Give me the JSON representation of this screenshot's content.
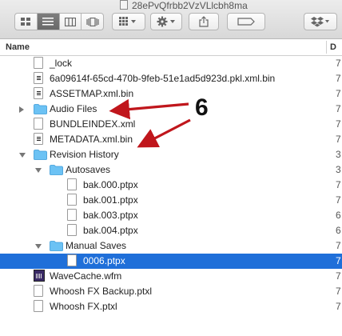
{
  "window": {
    "title": "28ePvQfrbb2VzVLlcbh8ma"
  },
  "toolbar": {
    "view_modes": [
      "icon-view",
      "list-view",
      "column-view",
      "coverflow-view"
    ],
    "active_view": "list-view",
    "arrange_icon": "arrange-grid-icon",
    "action_icon": "gear-icon",
    "share_icon": "share-icon",
    "tags_icon": "tag-icon",
    "dropbox_icon": "dropbox-icon"
  },
  "columns": {
    "name": "Name",
    "date": "D"
  },
  "rows": [
    {
      "label": "_lock",
      "kind": "doc",
      "indent": 0,
      "date": "7"
    },
    {
      "label": "6a09614f-65cd-470b-9feb-51e1ad5d923d.pkl.xml.bin",
      "kind": "bin",
      "indent": 0,
      "date": "7"
    },
    {
      "label": "ASSETMAP.xml.bin",
      "kind": "bin",
      "indent": 0,
      "date": "7"
    },
    {
      "label": "Audio Files",
      "kind": "folder",
      "indent": 0,
      "expanded": false,
      "date": "7"
    },
    {
      "label": "BUNDLEINDEX.xml",
      "kind": "doc",
      "indent": 0,
      "date": "7"
    },
    {
      "label": "METADATA.xml.bin",
      "kind": "bin",
      "indent": 0,
      "date": "7"
    },
    {
      "label": "Revision History",
      "kind": "folder",
      "indent": 0,
      "expanded": true,
      "date": "3"
    },
    {
      "label": "Autosaves",
      "kind": "folder",
      "indent": 1,
      "expanded": true,
      "date": "3"
    },
    {
      "label": "bak.000.ptpx",
      "kind": "doc",
      "indent": 2,
      "date": "7"
    },
    {
      "label": "bak.001.ptpx",
      "kind": "doc",
      "indent": 2,
      "date": "7"
    },
    {
      "label": "bak.003.ptpx",
      "kind": "doc",
      "indent": 2,
      "date": "6"
    },
    {
      "label": "bak.004.ptpx",
      "kind": "doc",
      "indent": 2,
      "date": "6"
    },
    {
      "label": "Manual Saves",
      "kind": "folder",
      "indent": 1,
      "expanded": true,
      "date": "7"
    },
    {
      "label": "0006.ptpx",
      "kind": "doc",
      "indent": 2,
      "date": "7",
      "selected": true
    },
    {
      "label": "WaveCache.wfm",
      "kind": "wfm",
      "indent": 0,
      "date": "7"
    },
    {
      "label": "Whoosh FX Backup.ptxl",
      "kind": "doc",
      "indent": 0,
      "date": "7"
    },
    {
      "label": "Whoosh FX.ptxl",
      "kind": "doc",
      "indent": 0,
      "date": "7"
    }
  ],
  "annotation": {
    "number": "6",
    "arrow_color": "#c0161c"
  },
  "colors": {
    "selection": "#1f6fd9",
    "folder": "#6cc2f4"
  }
}
